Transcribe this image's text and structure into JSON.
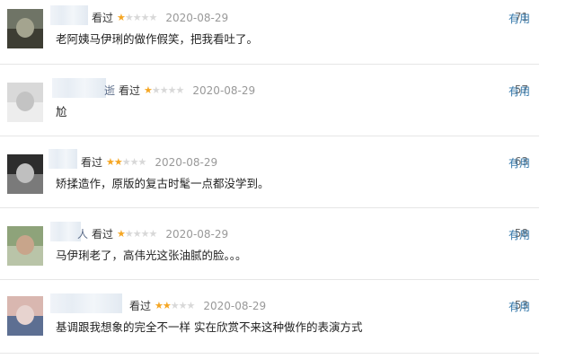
{
  "reviews": [
    {
      "name_tail": "",
      "action": "看过",
      "stars": 1,
      "date": "2020-08-29",
      "votes": "71",
      "useful_label": "有用",
      "text": "老阿姨马伊琍的做作假笑，把我看吐了。",
      "avatar_colors": [
        "#6f7466",
        "#3d3d33",
        "#a4a48f"
      ]
    },
    {
      "name_tail": "逝",
      "action": "看过",
      "stars": 1,
      "date": "2020-08-29",
      "votes": "57",
      "useful_label": "有用",
      "text": "尬",
      "avatar_colors": [
        "#d9d9d9",
        "#ededed",
        "#c3c3c3"
      ]
    },
    {
      "name_tail": "",
      "action": "看过",
      "stars": 2,
      "date": "2020-08-29",
      "votes": "63",
      "useful_label": "有用",
      "text": "矫揉造作，原版的复古时髦一点都没学到。",
      "avatar_colors": [
        "#2d2d2d",
        "#7a7a7a",
        "#bfbfbf"
      ]
    },
    {
      "name_tail": "人",
      "action": "看过",
      "stars": 1,
      "date": "2020-08-29",
      "votes": "58",
      "useful_label": "有用",
      "text": "马伊琍老了，高伟光这张油腻的脸。。。",
      "avatar_colors": [
        "#8ea37a",
        "#b9c4a8",
        "#c8a58b"
      ]
    },
    {
      "name_tail": "",
      "action": "看过",
      "stars": 2,
      "date": "2020-08-29",
      "votes": "53",
      "useful_label": "有用",
      "text": "基调跟我想象的完全不一样 实在欣赏不来这种做作的表演方式",
      "avatar_colors": [
        "#d9b7b0",
        "#5d6f92",
        "#e7d3cf"
      ]
    }
  ]
}
